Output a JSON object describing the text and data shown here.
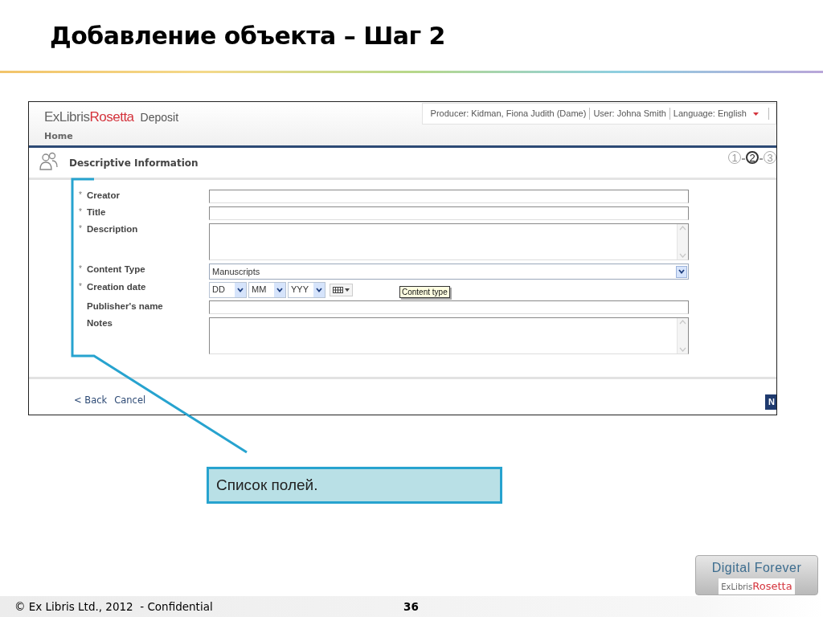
{
  "slide": {
    "title": "Добавление объекта – Шаг 2"
  },
  "app": {
    "logo": {
      "brand": "ExLibris",
      "product": "Rosetta",
      "module": "Deposit"
    },
    "header_info": [
      "Producer: Kidman, Fiona Judith (Dame)",
      "User: Johna Smith",
      "Language: English"
    ],
    "nav": [
      {
        "label": "Home"
      }
    ],
    "section_title": "Descriptive Information",
    "steps": [
      {
        "label": "1",
        "selected": false
      },
      {
        "label": "2",
        "selected": true
      },
      {
        "label": "3",
        "selected": false
      }
    ],
    "fields": [
      {
        "label": "Creator",
        "marker": "*",
        "kind": "text"
      },
      {
        "label": "Title",
        "marker": "*",
        "kind": "text"
      },
      {
        "label": "Description",
        "marker": "*",
        "kind": "textarea"
      },
      {
        "label": "Content Type",
        "marker": "*",
        "kind": "select",
        "value": "Manuscripts"
      },
      {
        "label": "Creation date",
        "marker": "*",
        "kind": "date",
        "parts": [
          "DD",
          "MM",
          "YYY"
        ]
      },
      {
        "label": "Publisher's name",
        "kind": "text"
      },
      {
        "label": "Notes",
        "kind": "textarea"
      }
    ],
    "tooltip": "Content type",
    "footer_links": [
      "< Back",
      "Cancel"
    ],
    "next_button": "N"
  },
  "callout": "Список полей.",
  "footer": {
    "copyright": "© Ex Libris Ltd., 2012  - Confidential",
    "page": "36",
    "badge": {
      "tagline": "Digital Forever",
      "brand": "ExLibris",
      "product": "Rosetta"
    }
  }
}
